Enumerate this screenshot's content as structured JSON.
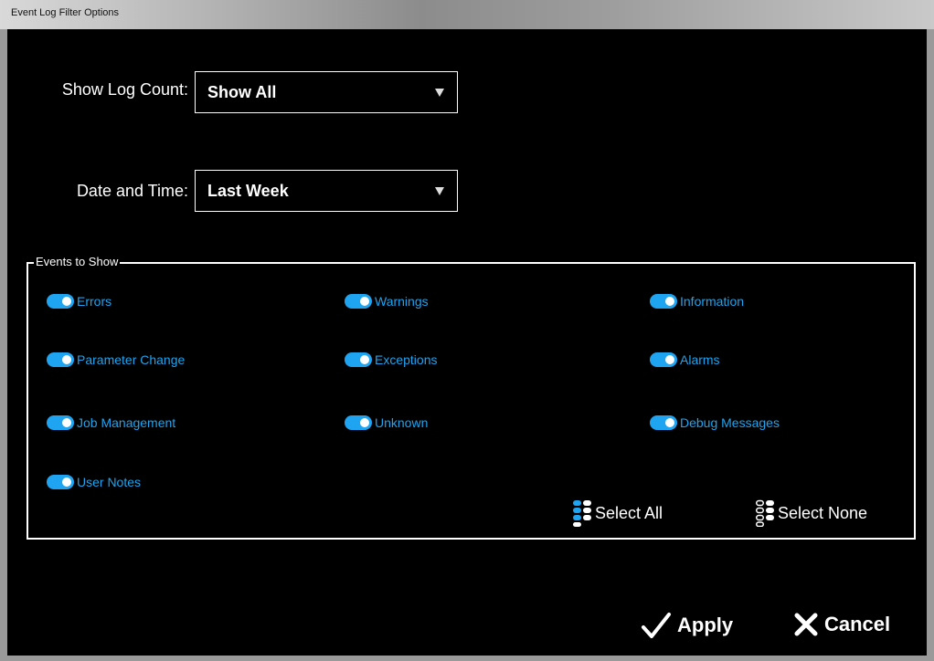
{
  "window": {
    "title": "Event Log Filter Options"
  },
  "form": {
    "log_count": {
      "label": "Show Log Count:",
      "value": "Show All"
    },
    "date_time": {
      "label": "Date and Time:",
      "value": "Last Week"
    }
  },
  "events": {
    "legend": "Events to Show",
    "toggles": [
      {
        "label": "Errors",
        "on": true
      },
      {
        "label": "Warnings",
        "on": true
      },
      {
        "label": "Information",
        "on": true
      },
      {
        "label": "Parameter Change",
        "on": true
      },
      {
        "label": "Exceptions",
        "on": true
      },
      {
        "label": "Alarms",
        "on": true
      },
      {
        "label": "Job Management",
        "on": true
      },
      {
        "label": "Unknown",
        "on": true
      },
      {
        "label": "Debug Messages",
        "on": true
      },
      {
        "label": "User Notes",
        "on": true
      }
    ],
    "select_all_label": "Select All",
    "select_none_label": "Select None"
  },
  "actions": {
    "apply_label": "Apply",
    "cancel_label": "Cancel"
  },
  "colors": {
    "accent": "#1ea4f0",
    "background": "#000000",
    "text": "#ffffff"
  },
  "icons": {
    "apply": "checkmark-icon",
    "cancel": "x-icon",
    "select_all": "toggle-list-on-icon",
    "select_none": "toggle-list-off-icon",
    "dropdown": "caret-down-icon"
  }
}
